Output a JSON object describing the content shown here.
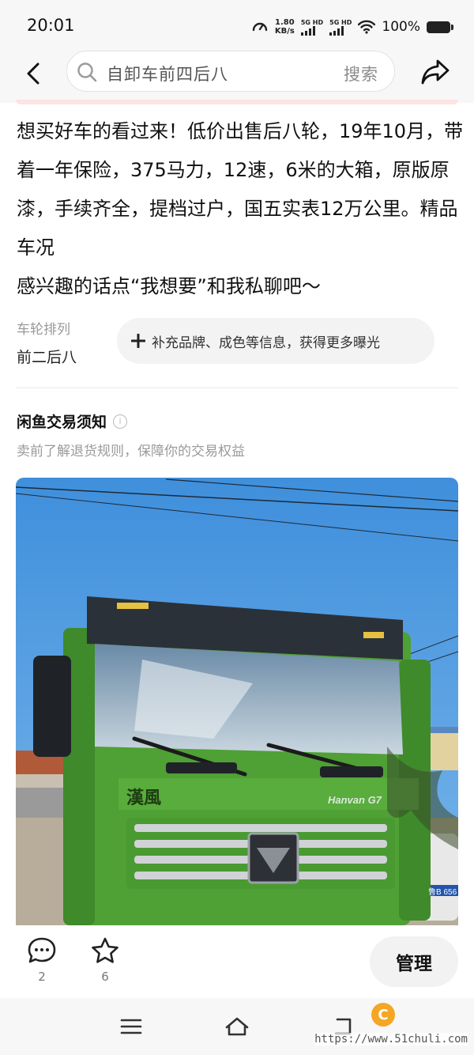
{
  "status_bar": {
    "time": "20:01",
    "net_speed_value": "1.80",
    "net_speed_unit": "KB/s",
    "sim1_label": "5G HD",
    "sim2_label": "5G HD",
    "battery_percent": "100%"
  },
  "header": {
    "search_query": "自卸车前四后八",
    "search_button": "搜索"
  },
  "description": {
    "line1": "想买好车的看过来！低价出售后八轮，19年10月，带着一年保险，375马力，12速，6米的大箱，原版原漆，手续齐全，提档过户，国五实表12万公里。精品车况",
    "line2": "感兴趣的话点“我想要”和我私聊吧～"
  },
  "attributes": {
    "label": "车轮排列",
    "value": "前二后八",
    "supplement_button": "补充品牌、成色等信息，获得更多曝光"
  },
  "trade_rules": {
    "title": "闲鱼交易须知",
    "info_icon": "i",
    "subtitle": "卖前了解退货规则，保障你的交易权益"
  },
  "photo": {
    "truck_brand_text": "漢風",
    "truck_model_text": "Hanvan G7",
    "plate_text": "鲁B 656"
  },
  "bottom_bar": {
    "comment_count": "2",
    "favorite_count": "6",
    "manage_label": "管理"
  },
  "watermark": {
    "logo_letter": "C",
    "url": "https://www.51chuli.com"
  },
  "colors": {
    "background": "#ffffff",
    "bar_background": "#f7f7f7",
    "truck_green": "#5aa83a",
    "sky_blue": "#4f9ee0"
  }
}
